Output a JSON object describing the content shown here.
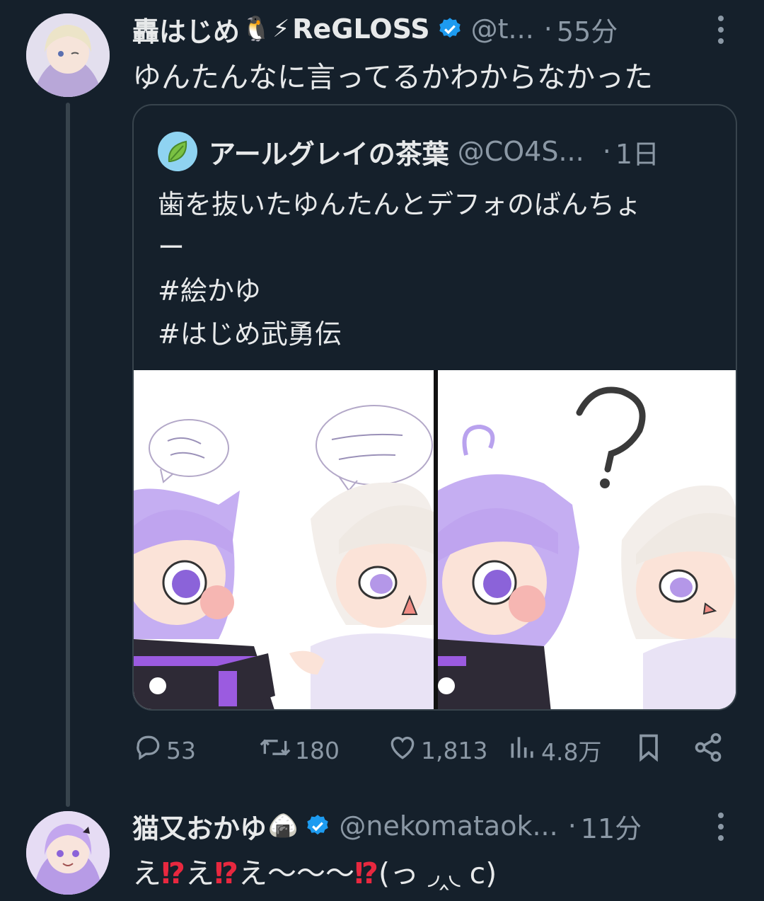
{
  "tweet1": {
    "display_name": "轟はじめ",
    "emoji_penguin": "🐧",
    "emoji_bolt": "⚡",
    "affiliation": "ReGLOSS",
    "handle": "@t...",
    "separator": "·",
    "time": "55分",
    "text": "ゆんたんなに言ってるかわからなかった"
  },
  "quote": {
    "display_name": "アールグレイの茶葉",
    "handle": "@CO4S...",
    "separator": "·",
    "time": "1日",
    "lines": [
      "歯を抜いたゆんたんとデフォのばんちょ",
      "ー",
      "#絵かゆ",
      "#はじめ武勇伝"
    ]
  },
  "actions": {
    "replies": "53",
    "retweets": "180",
    "likes": "1,813",
    "views": "4.8万"
  },
  "tweet2": {
    "display_name": "猫又おかゆ",
    "emoji": "🍙",
    "handle": "@nekomataok...",
    "separator": "·",
    "time": "11分",
    "text_parts": [
      "え",
      "⁉",
      "え",
      "⁉",
      "え〜〜〜",
      "⁉",
      "(っ ◞‸◟ c)"
    ]
  },
  "colors": {
    "background": "#15202b",
    "text": "#e7e9ea",
    "secondary": "#8b98a5",
    "border": "#38444d",
    "verified": "#1d9bf0",
    "accent_red": "#e8283f"
  },
  "icons": [
    "more-icon",
    "verified-icon",
    "reply-icon",
    "retweet-icon",
    "like-icon",
    "views-icon",
    "bookmark-icon",
    "share-icon",
    "leaf-icon"
  ]
}
